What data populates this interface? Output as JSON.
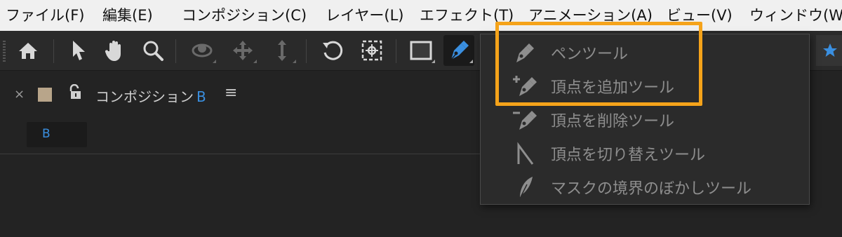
{
  "menubar": {
    "items": [
      "ファイル(F)",
      "編集(E)",
      "コンポジション(C)",
      "レイヤー(L)",
      "エフェクト(T)",
      "アニメーション(A)",
      "ビュー(V)",
      "ウィンドウ(W)"
    ]
  },
  "toolbar": {
    "tools": [
      "home-icon",
      "selection-arrow-icon",
      "hand-icon",
      "zoom-icon",
      "orbit-camera-icon",
      "pan-camera-icon",
      "dolly-camera-icon",
      "rotate-icon",
      "anchor-point-icon",
      "rectangle-icon",
      "pen-icon",
      "star-icon"
    ],
    "active_tool": "pen-icon",
    "accent_color": "#3a8fe0"
  },
  "panel": {
    "close_label": "×",
    "title": "コンポジション",
    "comp_name": "B",
    "menu_label": "≡",
    "comp_tab_label": "B"
  },
  "pen_menu": {
    "items": [
      {
        "label": "ペンツール",
        "icon": "pen-icon"
      },
      {
        "label": "頂点を追加ツール",
        "icon": "add-vertex-icon"
      },
      {
        "label": "頂点を削除ツール",
        "icon": "delete-vertex-icon"
      },
      {
        "label": "頂点を切り替えツール",
        "icon": "convert-vertex-icon"
      },
      {
        "label": "マスクの境界のぼかしツール",
        "icon": "mask-feather-icon"
      }
    ],
    "highlight_color": "#f5a31a"
  }
}
